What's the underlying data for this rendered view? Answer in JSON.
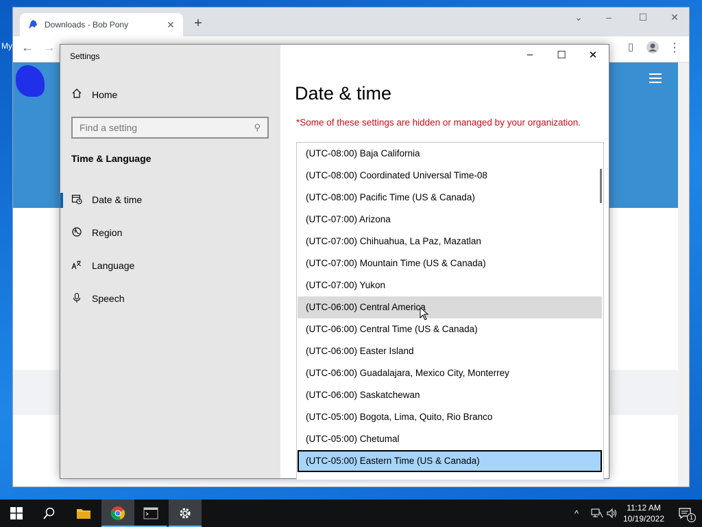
{
  "desktop": {
    "label": "My"
  },
  "browser": {
    "tab_title": "Downloads - Bob Pony",
    "new_tab": "+",
    "back": "←",
    "forward": "→"
  },
  "settings": {
    "window_title": "Settings",
    "home_label": "Home",
    "search_placeholder": "Find a setting",
    "section_heading": "Time & Language",
    "nav_items": [
      {
        "label": "Date & time",
        "icon": "date-time-icon"
      },
      {
        "label": "Region",
        "icon": "region-icon"
      },
      {
        "label": "Language",
        "icon": "language-icon"
      },
      {
        "label": "Speech",
        "icon": "microphone-icon"
      }
    ],
    "page_title": "Date & time",
    "org_notice": "*Some of these settings are hidden or managed by your organization.",
    "timezones": [
      "(UTC-08:00) Baja California",
      "(UTC-08:00) Coordinated Universal Time-08",
      "(UTC-08:00) Pacific Time (US & Canada)",
      "(UTC-07:00) Arizona",
      "(UTC-07:00) Chihuahua, La Paz, Mazatlan",
      "(UTC-07:00) Mountain Time (US & Canada)",
      "(UTC-07:00) Yukon",
      "(UTC-06:00) Central America",
      "(UTC-06:00) Central Time (US & Canada)",
      "(UTC-06:00) Easter Island",
      "(UTC-06:00) Guadalajara, Mexico City, Monterrey",
      "(UTC-06:00) Saskatchewan",
      "(UTC-05:00) Bogota, Lima, Quito, Rio Branco",
      "(UTC-05:00) Chetumal",
      "(UTC-05:00) Eastern Time (US & Canada)"
    ],
    "hovered_timezone": "(UTC-06:00) Central America",
    "selected_timezone": "(UTC-05:00) Eastern Time (US & Canada)"
  },
  "taskbar": {
    "time": "11:12 AM",
    "date": "10/19/2022",
    "notification_count": "1"
  },
  "colors": {
    "accent": "#0063b1",
    "selected_item_bg": "#a7d4fb",
    "hover_item_bg": "#dadada",
    "notice_red": "#c50f1f"
  }
}
